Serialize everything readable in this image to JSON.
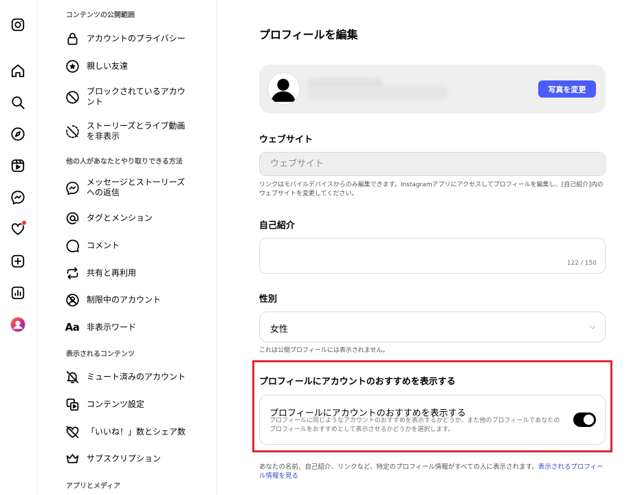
{
  "menu": {
    "sections": {
      "visibility": "コンテンツの公開範囲",
      "interaction": "他の人があなたとやり取りできる方法",
      "content_shown": "表示されるコンテンツ",
      "apps_media": "アプリとメディア"
    },
    "items": {
      "privacy": "アカウントのプライバシー",
      "close_friends": "親しい友達",
      "blocked_1": "ブロックされているアカウ",
      "blocked_2": "ント",
      "hide_story_1": "ストーリーズとライブ動画",
      "hide_story_2": "を非表示",
      "messages_1": "メッセージとストーリーズ",
      "messages_2": "への返信",
      "tags": "タグとメンション",
      "comments": "コメント",
      "sharing": "共有と再利用",
      "restricted": "制限中のアカウント",
      "hidden_words_icon": "Aa",
      "hidden_words": "非表示ワード",
      "muted": "ミュート済みのアカウント",
      "content_settings": "コンテンツ設定",
      "likes_shares": "「いいね！」数とシェア数",
      "subscriptions": "サブスクリプション"
    }
  },
  "main": {
    "title": "プロフィールを編集",
    "change_photo": "写真を変更",
    "website_label": "ウェブサイト",
    "website_placeholder": "ウェブサイト",
    "website_help": "リンクはモバイルデバイスからのみ編集できます。Instagramアプリにアクセスしてプロフィールを編集し、[自己紹介]内のウェブサイトを変更してください。",
    "bio_label": "自己紹介",
    "bio_count": "122 / 150",
    "gender_label": "性別",
    "gender_value": "女性",
    "gender_help": "これは公開プロフィールには表示されません。",
    "suggest_heading": "プロフィールにアカウントのおすすめを表示する",
    "suggest_card_title": "プロフィールにアカウントのおすすめを表示する",
    "suggest_card_desc": "プロフィールに同じようなアカウントのおすすめを表示するかどうか、また他のプロフィールであなたのプロフィールをおすすめとして表示させるかどうかを選択します。",
    "suggest_enabled": true,
    "footer_text": "あなたの名前、自己紹介、リンクなど、特定のプロフィール情報がすべての人に表示されます。",
    "footer_link": "表示されるプロフィール情報を見る"
  },
  "colors": {
    "accent": "#4a5df9",
    "highlight": "#e0262e",
    "link": "#3652b8",
    "notification": "#ff3040"
  },
  "icons": {
    "rail": [
      "instagram-icon",
      "home-icon",
      "search-icon",
      "explore-icon",
      "reels-icon",
      "messenger-icon",
      "heart-icon",
      "create-icon",
      "dashboard-icon",
      "profile-avatar-icon"
    ]
  }
}
